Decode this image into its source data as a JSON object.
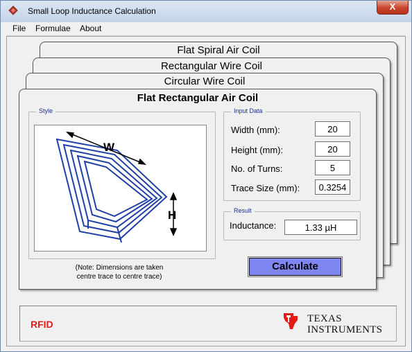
{
  "window": {
    "title": "Small Loop Inductance Calculation",
    "close_glyph": "X"
  },
  "menu": [
    "File",
    "Formulae",
    "About"
  ],
  "tabs": [
    "Flat Spiral Air Coil",
    "Rectangular Wire Coil",
    "Circular Wire Coil",
    "Flat Rectangular Air Coil"
  ],
  "style_group": {
    "legend": "Style",
    "diagram_labels": {
      "width": "W",
      "height": "H"
    },
    "note_line1": "(Note: Dimensions are taken",
    "note_line2": "centre trace to centre trace)"
  },
  "input_group": {
    "legend": "Input Data",
    "fields": [
      {
        "label": "Width (mm):",
        "value": "20"
      },
      {
        "label": "Height (mm):",
        "value": "20"
      },
      {
        "label": "No. of Turns:",
        "value": "5"
      },
      {
        "label": "Trace Size (mm):",
        "value": "0.3254"
      }
    ]
  },
  "result_group": {
    "legend": "Result",
    "label": "Inductance:",
    "value": "1.33 µH"
  },
  "calculate_label": "Calculate",
  "footer": {
    "rfid": "RFID",
    "company_line1": "Texas",
    "company_line2": "Instruments"
  },
  "colors": {
    "accent_button": "#7f86f2",
    "legend_text": "#1a2e8c",
    "rfid": "#e21b16",
    "coil": "#1f3fa6"
  }
}
